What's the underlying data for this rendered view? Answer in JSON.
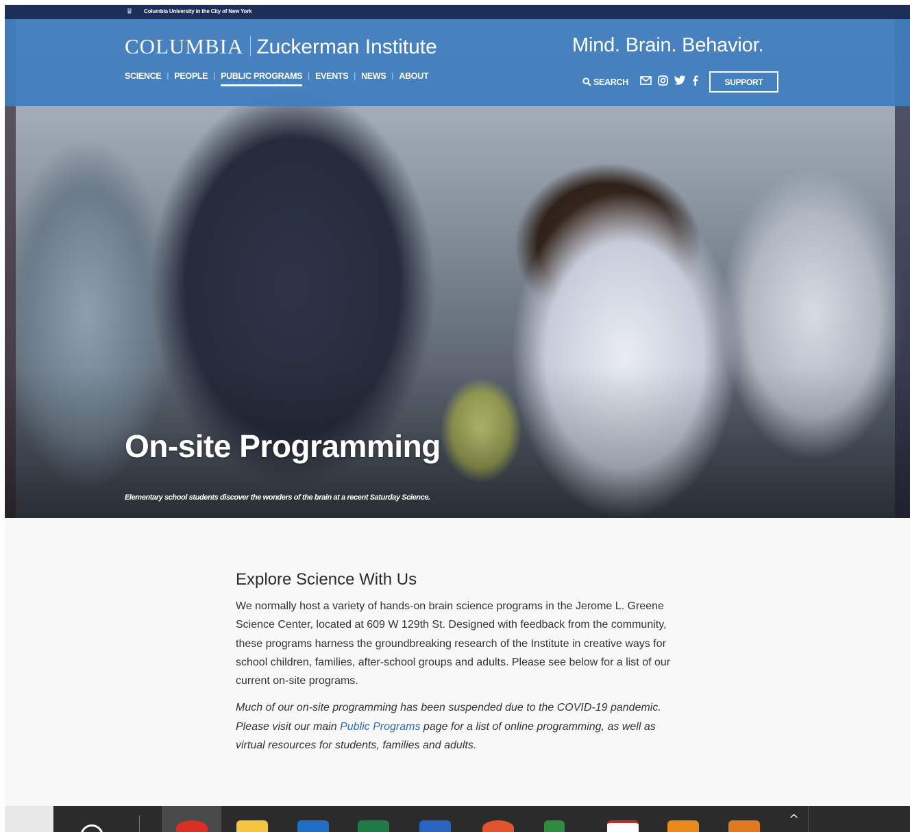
{
  "university_bar": {
    "text": "Columbia University in the City of New York",
    "crown": "♛"
  },
  "header": {
    "logo_columbia": "COLUMBIA",
    "logo_institute": "Zuckerman Institute",
    "tagline": "Mind. Brain. Behavior.",
    "nav": [
      {
        "label": "SCIENCE",
        "active": false
      },
      {
        "label": "PEOPLE",
        "active": false
      },
      {
        "label": "PUBLIC PROGRAMS",
        "active": true
      },
      {
        "label": "EVENTS",
        "active": false
      },
      {
        "label": "NEWS",
        "active": false
      },
      {
        "label": "ABOUT",
        "active": false
      }
    ],
    "search_label": "SEARCH",
    "social_icons": [
      "mail-icon",
      "instagram-icon",
      "twitter-icon",
      "facebook-icon"
    ],
    "support_label": "SUPPORT",
    "colors": {
      "header_blue": "#3e7dbe",
      "top_bar": "#1d2e5a"
    }
  },
  "hero": {
    "title": "On-site Programming",
    "caption": "Elementary school students discover the wonders of the brain at a recent Saturday Science."
  },
  "main": {
    "heading": "Explore Science With Us",
    "body": "We normally host a variety of hands-on brain science programs in the Jerome L. Greene Science Center, located at 609 W 129th St. Designed with feedback from the community, these programs harness the groundbreaking research of the Institute in creative ways for school children, families, after-school groups and adults. Please see below for a list of our current on-site programs.",
    "note_before": "Much of our on-site programming has been suspended due to the COVID-19 pandemic. Please visit our main ",
    "note_link": "Public Programs",
    "note_after": " page for a list of online programming, as well as virtual resources for students, families and adults.",
    "link_color": "#2e6ba8"
  },
  "taskbar": {
    "caret": "^",
    "apps": [
      "cortana-search",
      "chrome",
      "file-explorer",
      "outlook",
      "excel",
      "word",
      "powerpoint",
      "project",
      "acrobat",
      "app-orange",
      "app-blue"
    ]
  }
}
